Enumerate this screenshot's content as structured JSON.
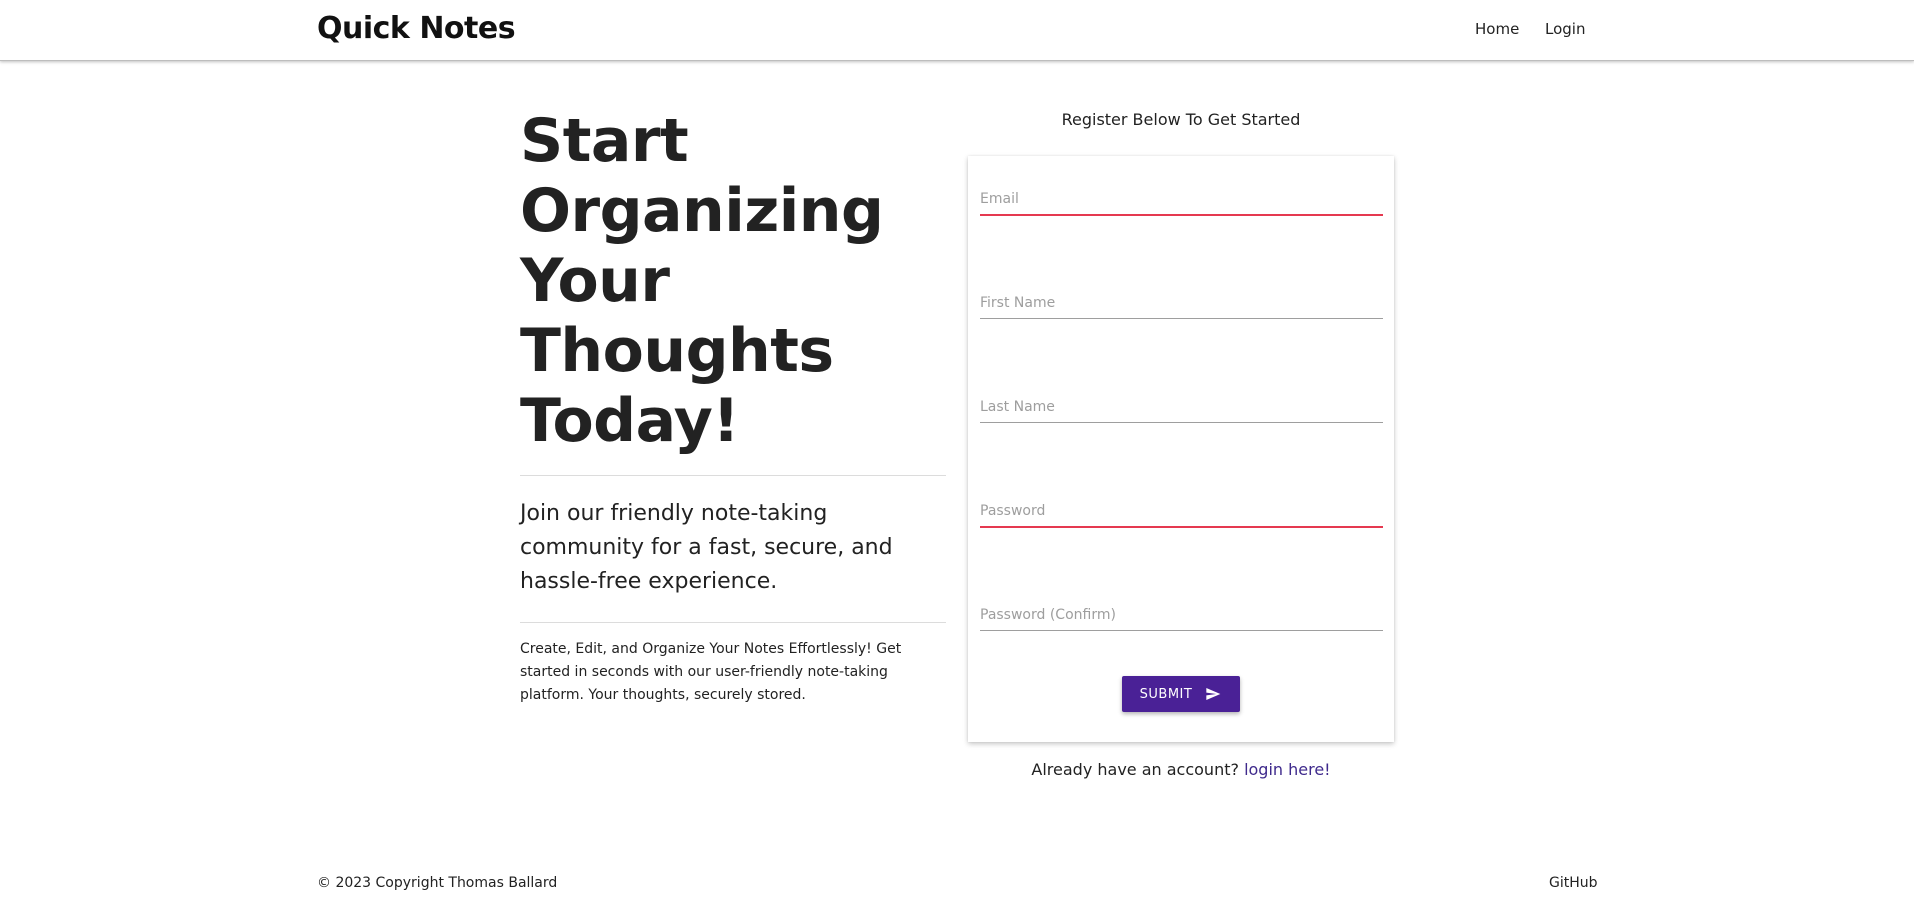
{
  "header": {
    "brand": "Quick Notes",
    "nav": {
      "home": "Home",
      "login": "Login"
    }
  },
  "hero": {
    "title": "Start Organizing Your Thoughts Today!",
    "subtitle": "Join our friendly note-taking community for a fast, secure, and hassle-free experience.",
    "description": "Create, Edit, and Organize Your Notes Effortlessly! Get started in seconds with our user-friendly note-taking platform. Your thoughts, securely stored."
  },
  "register": {
    "heading": "Register Below To Get Started",
    "fields": {
      "email": {
        "placeholder": "Email",
        "value": ""
      },
      "first_name": {
        "placeholder": "First Name",
        "value": ""
      },
      "last_name": {
        "placeholder": "Last Name",
        "value": ""
      },
      "password": {
        "placeholder": "Password",
        "value": ""
      },
      "password_confirm": {
        "placeholder": "Password (Confirm)",
        "value": ""
      }
    },
    "submit_label": "SUBMIT",
    "submit_icon": "send-icon",
    "already_text": "Already have an account? ",
    "login_link": "login here!"
  },
  "footer": {
    "copyright": "© 2023 Copyright Thomas Ballard",
    "github": "GitHub"
  },
  "colors": {
    "accent": "#4a2196",
    "invalid_underline": "#e53950",
    "link": "#3f2a8c"
  }
}
